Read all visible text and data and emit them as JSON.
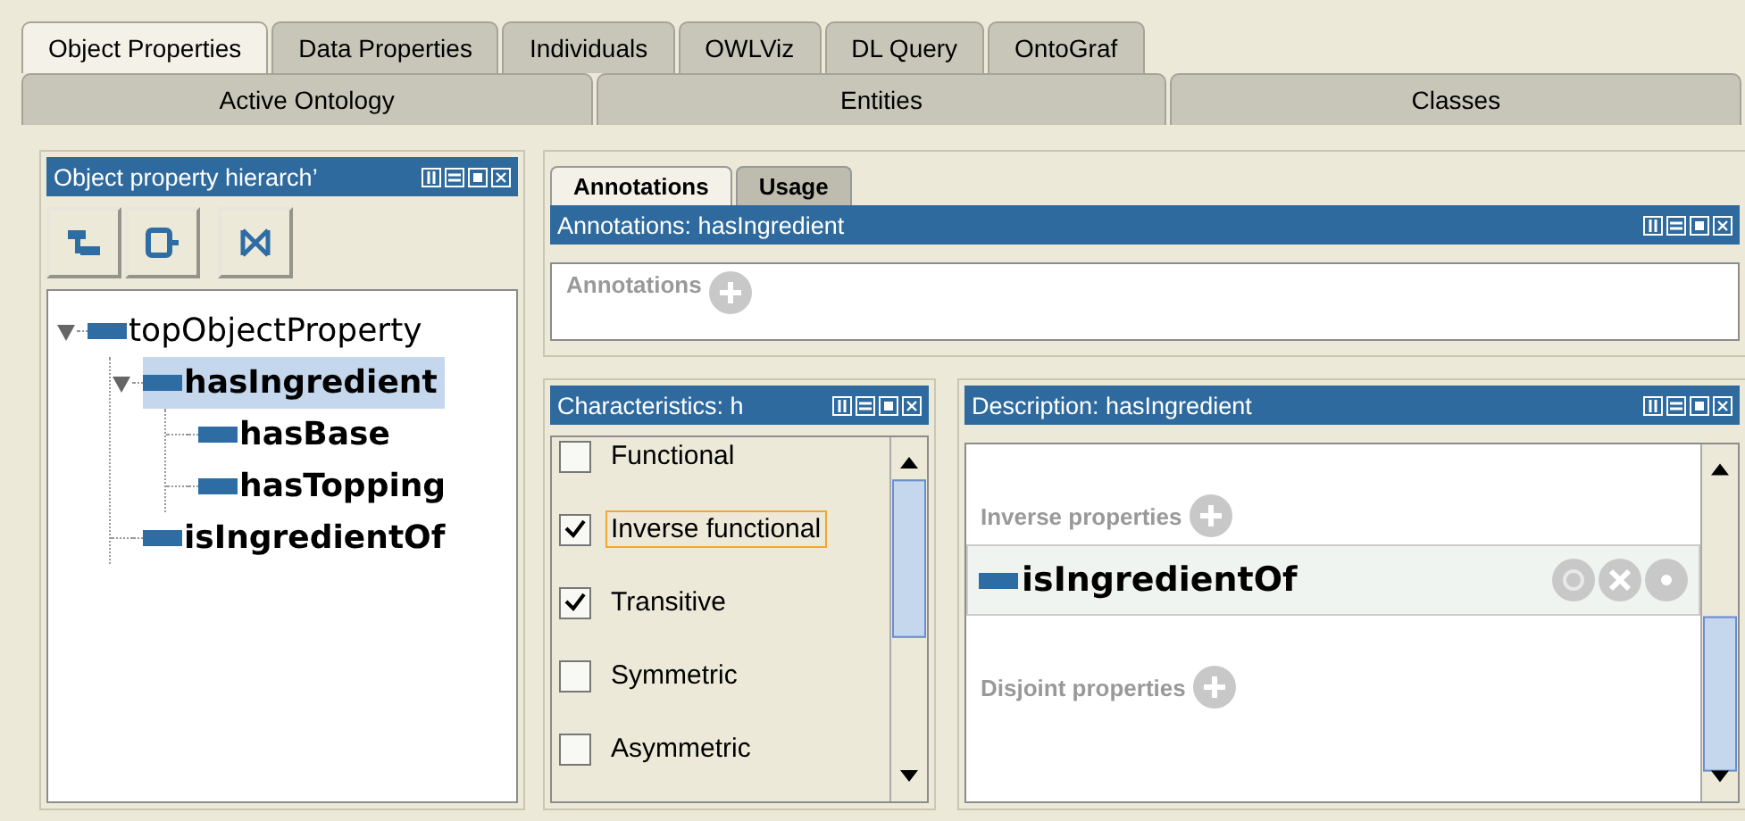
{
  "tab_rows": [
    {
      "tabs": [
        {
          "label": "Object Properties",
          "selected": true
        },
        {
          "label": "Data Properties",
          "selected": false
        },
        {
          "label": "Individuals",
          "selected": false
        },
        {
          "label": "OWLViz",
          "selected": false
        },
        {
          "label": "DL Query",
          "selected": false
        },
        {
          "label": "OntoGraf",
          "selected": false
        }
      ]
    },
    {
      "tabs": [
        {
          "label": "Active Ontology",
          "selected": false
        },
        {
          "label": "Entities",
          "selected": false
        },
        {
          "label": "Classes",
          "selected": false
        }
      ]
    }
  ],
  "hierarchy": {
    "title": "Object property hierarch’",
    "tree": [
      {
        "label": "topObjectProperty",
        "selected": false,
        "expanded": true,
        "children": [
          {
            "label": "hasIngredient",
            "selected": true,
            "expanded": true,
            "children": [
              {
                "label": "hasBase",
                "selected": false
              },
              {
                "label": "hasTopping",
                "selected": false
              }
            ]
          },
          {
            "label": "isIngredientOf",
            "selected": false
          }
        ]
      }
    ]
  },
  "annotation_tabs": [
    {
      "label": "Annotations",
      "selected": true
    },
    {
      "label": "Usage",
      "selected": false
    }
  ],
  "annotations": {
    "title": "Annotations: hasIngredient",
    "section": "Annotations"
  },
  "characteristics": {
    "title": "Characteristics: h",
    "items": [
      {
        "label": "Functional",
        "checked": false,
        "focused": false
      },
      {
        "label": "Inverse functional",
        "checked": true,
        "focused": true
      },
      {
        "label": "Transitive",
        "checked": true,
        "focused": false
      },
      {
        "label": "Symmetric",
        "checked": false,
        "focused": false
      },
      {
        "label": "Asymmetric",
        "checked": false,
        "focused": false
      }
    ]
  },
  "description": {
    "title": "Description: hasIngredient",
    "sections": [
      {
        "label": "Inverse properties",
        "items": [
          "isIngredientOf"
        ]
      },
      {
        "label": "Disjoint properties"
      }
    ]
  }
}
